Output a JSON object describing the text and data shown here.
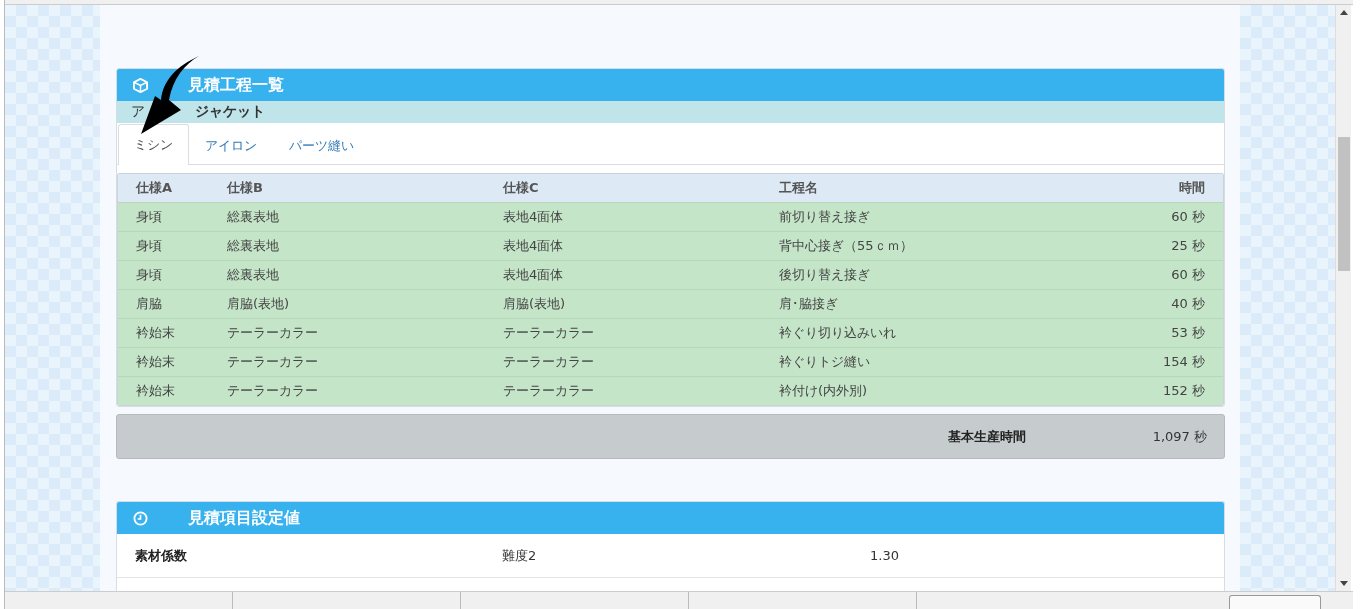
{
  "process_panel": {
    "title": "見積工程一覧",
    "item_label": "ア",
    "item_value": "ジャケット",
    "tabs": [
      {
        "label": "ミシン",
        "selected": true
      },
      {
        "label": "アイロン",
        "selected": false
      },
      {
        "label": "パーツ縫い",
        "selected": false
      }
    ],
    "columns": [
      "仕様A",
      "仕様B",
      "仕様C",
      "工程名",
      "時間"
    ],
    "rows": [
      [
        "身頃",
        "総裏表地",
        "表地4面体",
        "前切り替え接ぎ",
        "60 秒"
      ],
      [
        "身頃",
        "総裏表地",
        "表地4面体",
        "背中心接ぎ（55ｃｍ）",
        "25 秒"
      ],
      [
        "身頃",
        "総裏表地",
        "表地4面体",
        "後切り替え接ぎ",
        "60 秒"
      ],
      [
        "肩脇",
        "肩脇(表地)",
        "肩脇(表地)",
        "肩･脇接ぎ",
        "40 秒"
      ],
      [
        "衿始末",
        "テーラーカラー",
        "テーラーカラー",
        "衿ぐり切り込みいれ",
        "53 秒"
      ],
      [
        "衿始末",
        "テーラーカラー",
        "テーラーカラー",
        "衿ぐりトジ縫い",
        "154 秒"
      ],
      [
        "衿始末",
        "テーラーカラー",
        "テーラーカラー",
        "衿付け(内外別)",
        "152 秒"
      ]
    ],
    "footer": {
      "label": "基本生産時間",
      "value": "1,097 秒"
    }
  },
  "settings_panel": {
    "title": "見積項目設定値",
    "rows": [
      [
        "素材係数",
        "難度2",
        "1.30"
      ]
    ]
  }
}
